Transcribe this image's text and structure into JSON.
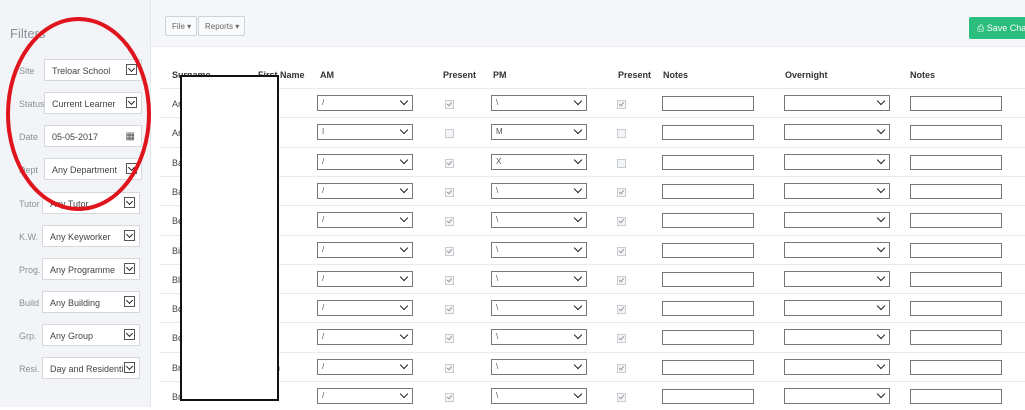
{
  "sidebar": {
    "title": "Filters",
    "filters": [
      {
        "label": "Site",
        "value": "Treloar School",
        "control": "dropdown"
      },
      {
        "label": "Status",
        "value": "Current Learner",
        "control": "dropdown"
      },
      {
        "label": "Date",
        "value": "05-05-2017",
        "control": "date"
      },
      {
        "label": "Dept",
        "value": "Any Department",
        "control": "dropdown"
      },
      {
        "label": "Tutor",
        "value": "Any Tutor",
        "control": "dropdown"
      },
      {
        "label": "K.W.",
        "value": "Any Keyworker",
        "control": "dropdown"
      },
      {
        "label": "Prog.",
        "value": "Any Programme",
        "control": "dropdown"
      },
      {
        "label": "Build",
        "value": "Any Building",
        "control": "dropdown"
      },
      {
        "label": "Grp.",
        "value": "Any Group",
        "control": "dropdown"
      },
      {
        "label": "Resi.",
        "value": "Day and Residential",
        "control": "dropdown"
      }
    ]
  },
  "toolbar": {
    "file_label": "File ▾",
    "reports_label": "Reports ▾",
    "save_label": "⎙ Save Changes"
  },
  "table": {
    "headers": {
      "surname": "Surname",
      "first_name": "First Name",
      "am": "AM",
      "present_am": "Present",
      "pm": "PM",
      "present_pm": "Present",
      "notes": "Notes",
      "overnight": "Overnight",
      "notes2": "Notes"
    },
    "rows": [
      {
        "surname": "An",
        "first": "",
        "am": "/",
        "am_present": true,
        "pm": "\\",
        "pm_present": true
      },
      {
        "surname": "An",
        "first": "e",
        "am": "I",
        "am_present": false,
        "pm": "M",
        "pm_present": false
      },
      {
        "surname": "Ba",
        "first": "",
        "am": "/",
        "am_present": true,
        "pm": "X",
        "pm_present": false
      },
      {
        "surname": "Ba",
        "first": "re",
        "am": "/",
        "am_present": true,
        "pm": "\\",
        "pm_present": true
      },
      {
        "surname": "Be",
        "first": "",
        "am": "/",
        "am_present": true,
        "pm": "\\",
        "pm_present": true
      },
      {
        "surname": "Bi",
        "first": "",
        "am": "/",
        "am_present": true,
        "pm": "\\",
        "pm_present": true
      },
      {
        "surname": "Bl",
        "first": "ce",
        "am": "/",
        "am_present": true,
        "pm": "\\",
        "pm_present": true
      },
      {
        "surname": "Bo",
        "first": "",
        "am": "/",
        "am_present": true,
        "pm": "\\",
        "pm_present": true
      },
      {
        "surname": "Bo",
        "first": "",
        "am": "/",
        "am_present": true,
        "pm": "\\",
        "pm_present": true
      },
      {
        "surname": "Br",
        "first": "on",
        "am": "/",
        "am_present": true,
        "pm": "\\",
        "pm_present": true
      },
      {
        "surname": "Br",
        "first": "te",
        "am": "/",
        "am_present": true,
        "pm": "\\",
        "pm_present": true
      }
    ]
  },
  "colors": {
    "accent_green": "#2bbd7e",
    "annotation_red": "#e0141c"
  }
}
